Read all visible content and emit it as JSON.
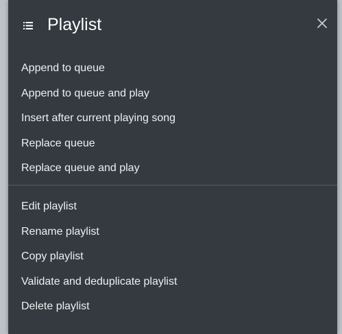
{
  "dialog": {
    "title": "Playlist",
    "title_icon": "list-icon",
    "close_icon": "close-icon",
    "close_glyph": "×"
  },
  "queue_actions": [
    {
      "label": "Append to queue"
    },
    {
      "label": "Append to queue and play"
    },
    {
      "label": "Insert after current playing song"
    },
    {
      "label": "Replace queue"
    },
    {
      "label": "Replace queue and play"
    }
  ],
  "playlist_actions": [
    {
      "label": "Edit playlist"
    },
    {
      "label": "Rename playlist"
    },
    {
      "label": "Copy playlist"
    },
    {
      "label": "Validate and deduplicate playlist"
    },
    {
      "label": "Delete playlist"
    }
  ],
  "colors": {
    "panel_background": "#343a40",
    "text": "#eef0f2",
    "divider": "#555c63"
  }
}
